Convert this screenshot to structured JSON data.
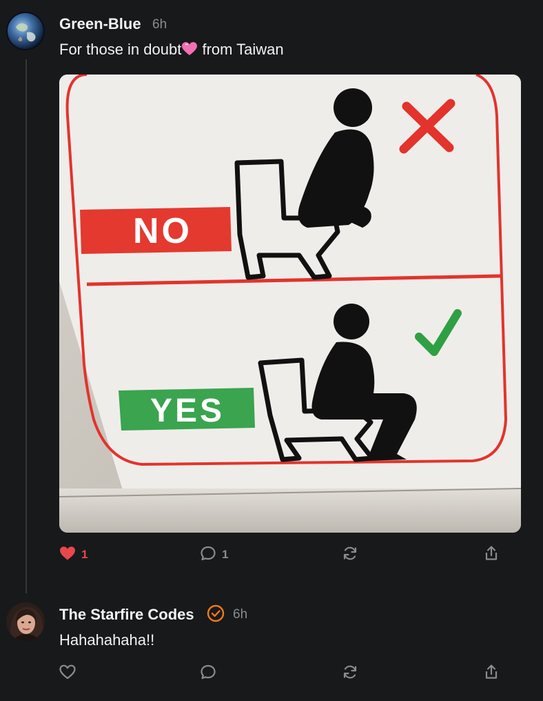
{
  "post": {
    "author": "Green-Blue",
    "time": "6h",
    "text": "For those in doubt",
    "text_emoji": "heart-icon",
    "text_suffix": " from Taiwan",
    "image": {
      "no_label": "NO",
      "yes_label": "YES"
    },
    "actions": {
      "like_count": "1",
      "liked": true,
      "reply_count": "1"
    }
  },
  "reply": {
    "author": "The Starfire Codes",
    "verified": true,
    "time": "6h",
    "text": "Hahahahaha!!"
  },
  "colors": {
    "background": "#18191b",
    "like_active": "#e8484a",
    "verified_badge": "#f07a1a",
    "muted": "#8a8c90"
  }
}
